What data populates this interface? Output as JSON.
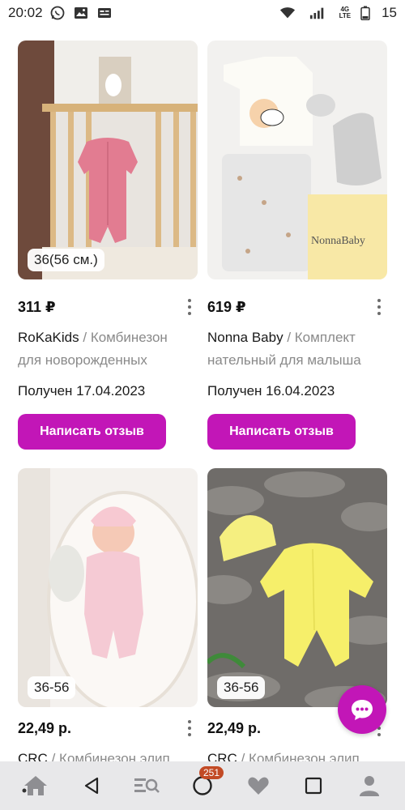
{
  "status_bar": {
    "time": "20:02",
    "network": "4G LTE",
    "battery": "15"
  },
  "products": [
    {
      "price": "311 ₽",
      "brand": "RoKaKids",
      "separator": "/",
      "name": "Комбинезон для новорожденных",
      "line1_name": "Комбинезон",
      "line2": "для новорожденных",
      "received": "Получен 17.04.2023",
      "size": "36(56 см.)",
      "button": "Написать отзыв"
    },
    {
      "price": "619 ₽",
      "brand": "Nonna Baby",
      "separator": "/",
      "name": "Комплект нательный для малыша",
      "line1_name": "Комплект",
      "line2": "нательный для малыша",
      "received": "Получен 16.04.2023",
      "size": "",
      "logo_text": "NonnaBaby",
      "button": "Написать отзыв"
    },
    {
      "price": "22,49 р.",
      "brand": "CRC",
      "separator": "/",
      "line1_name": "Комбинезон элип",
      "size": "36-56"
    },
    {
      "price": "22,49 р.",
      "brand": "CRC",
      "separator": "/",
      "line1_name": "Комбинезон элип",
      "size": "36-56"
    }
  ],
  "nav": {
    "cart_badge": "251"
  },
  "colors": {
    "accent": "#c216b7",
    "badge": "#c24a25"
  }
}
